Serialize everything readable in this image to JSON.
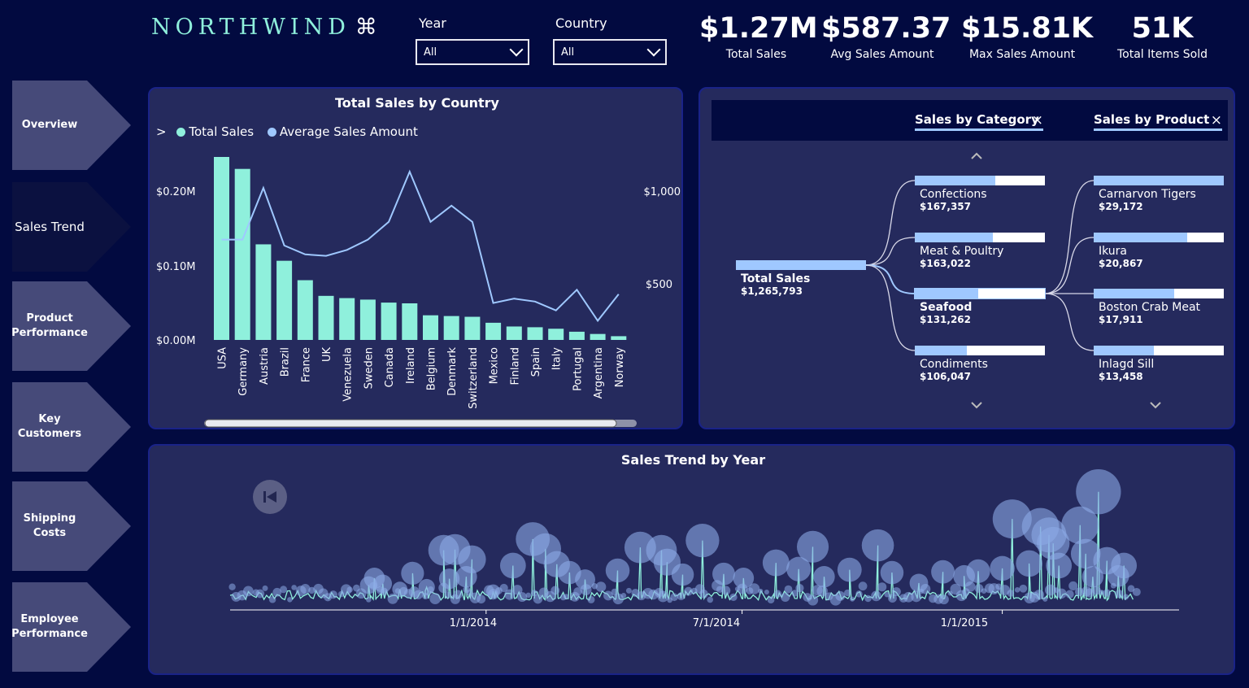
{
  "header": {
    "brand": "NORTHWIND",
    "brand_icon": "⌘",
    "filters": [
      {
        "label": "Year",
        "value": "All"
      },
      {
        "label": "Country",
        "value": "All"
      }
    ],
    "kpis": [
      {
        "value": "$1.27M",
        "label": "Total Sales"
      },
      {
        "value": "$587.37",
        "label": "Avg Sales Amount"
      },
      {
        "value": "$15.81K",
        "label": "Max Sales Amount"
      },
      {
        "value": "51K",
        "label": "Total Items Sold"
      }
    ]
  },
  "nav": [
    {
      "label": "Overview",
      "active": false
    },
    {
      "label": "Sales Trend",
      "active": true
    },
    {
      "label": "Product Performance",
      "active": false
    },
    {
      "label": "Key Customers",
      "active": false
    },
    {
      "label": "Shipping Costs",
      "active": false
    },
    {
      "label": "Employee Performance",
      "active": false
    }
  ],
  "country_chart": {
    "title": "Total Sales by Country",
    "legend_marker": ">",
    "legend": [
      {
        "name": "Total Sales",
        "color": "#8ff0dc"
      },
      {
        "name": "Average Sales Amount",
        "color": "#9fc8ff"
      }
    ],
    "y_left_ticks": [
      "$0.20M",
      "$0.10M",
      "$0.00M"
    ],
    "y_right_ticks": [
      "$1,000",
      "$500"
    ]
  },
  "decomp_tree": {
    "headers": [
      "Sales by Category",
      "Sales by Product"
    ],
    "root": {
      "name": "Total Sales",
      "value": "$1,265,793",
      "fraction": 1.0
    },
    "categories": [
      {
        "name": "Confections",
        "value": "$167,357",
        "fraction": 0.62
      },
      {
        "name": "Meat & Poultry",
        "value": "$163,022",
        "fraction": 0.6
      },
      {
        "name": "Seafood",
        "value": "$131,262",
        "fraction": 0.49,
        "selected": true
      },
      {
        "name": "Condiments",
        "value": "$106,047",
        "fraction": 0.4
      }
    ],
    "products": [
      {
        "name": "Carnarvon Tigers",
        "value": "$29,172",
        "fraction": 1.0
      },
      {
        "name": "Ikura",
        "value": "$20,867",
        "fraction": 0.72
      },
      {
        "name": "Boston Crab Meat",
        "value": "$17,911",
        "fraction": 0.62
      },
      {
        "name": "Inlagd Sill",
        "value": "$13,458",
        "fraction": 0.46
      }
    ]
  },
  "trend_chart": {
    "title": "Sales Trend by Year",
    "x_ticks": [
      "1/1/2014",
      "7/1/2014",
      "1/1/2015"
    ]
  },
  "chart_data": [
    {
      "type": "bar",
      "title": "Total Sales by Country",
      "categories": [
        "USA",
        "Germany",
        "Austria",
        "Brazil",
        "France",
        "UK",
        "Venezuela",
        "Sweden",
        "Canada",
        "Ireland",
        "Belgium",
        "Denmark",
        "Switzerland",
        "Mexico",
        "Finland",
        "Spain",
        "Italy",
        "Portugal",
        "Argentina",
        "Norway"
      ],
      "series": [
        {
          "name": "Total Sales",
          "axis": "left",
          "type": "bar",
          "values": [
            245000,
            229000,
            128000,
            106000,
            80000,
            59000,
            56000,
            54000,
            50000,
            49000,
            33000,
            32000,
            31000,
            23000,
            18000,
            17000,
            15000,
            11000,
            8000,
            5000
          ]
        },
        {
          "name": "Average Sales Amount",
          "axis": "right",
          "type": "line",
          "values": [
            680,
            680,
            1030,
            640,
            580,
            570,
            610,
            680,
            800,
            1140,
            800,
            910,
            800,
            250,
            280,
            260,
            200,
            340,
            130,
            310
          ]
        }
      ],
      "ylim_left": [
        0,
        245000
      ],
      "ylim_right": [
        0,
        1240
      ],
      "legend": "top-left"
    },
    {
      "type": "line",
      "title": "Sales Trend by Year",
      "x_ticks": [
        "1/1/2014",
        "7/1/2014",
        "1/1/2015"
      ],
      "x_range": [
        "2013-07-04",
        "2015-05-06"
      ],
      "note_markers": "bubble size proportional to order value",
      "points": [
        {
          "date": "2013-10-10",
          "value": 2400
        },
        {
          "date": "2013-10-14",
          "value": 3400
        },
        {
          "date": "2013-10-20",
          "value": 2600
        },
        {
          "date": "2013-11-01",
          "value": 1800
        },
        {
          "date": "2013-11-10",
          "value": 4100
        },
        {
          "date": "2013-11-20",
          "value": 2100
        },
        {
          "date": "2013-12-02",
          "value": 7400
        },
        {
          "date": "2013-12-06",
          "value": 3300
        },
        {
          "date": "2013-12-10",
          "value": 7500
        },
        {
          "date": "2013-12-18",
          "value": 3600
        },
        {
          "date": "2013-12-22",
          "value": 6100
        },
        {
          "date": "2014-01-06",
          "value": 1500
        },
        {
          "date": "2014-01-20",
          "value": 5200
        },
        {
          "date": "2014-02-03",
          "value": 9000
        },
        {
          "date": "2014-02-12",
          "value": 7600
        },
        {
          "date": "2014-02-20",
          "value": 5400
        },
        {
          "date": "2014-03-01",
          "value": 4200
        },
        {
          "date": "2014-03-12",
          "value": 3200
        },
        {
          "date": "2014-04-04",
          "value": 4500
        },
        {
          "date": "2014-04-20",
          "value": 7800
        },
        {
          "date": "2014-05-05",
          "value": 7400
        },
        {
          "date": "2014-05-09",
          "value": 5700
        },
        {
          "date": "2014-05-20",
          "value": 3900
        },
        {
          "date": "2014-06-03",
          "value": 8800
        },
        {
          "date": "2014-06-18",
          "value": 4000
        },
        {
          "date": "2014-07-02",
          "value": 3400
        },
        {
          "date": "2014-07-25",
          "value": 5600
        },
        {
          "date": "2014-08-10",
          "value": 4700
        },
        {
          "date": "2014-08-20",
          "value": 7900
        },
        {
          "date": "2014-08-28",
          "value": 3600
        },
        {
          "date": "2014-09-15",
          "value": 4600
        },
        {
          "date": "2014-10-05",
          "value": 8100
        },
        {
          "date": "2014-10-15",
          "value": 4200
        },
        {
          "date": "2014-11-03",
          "value": 2700
        },
        {
          "date": "2014-11-20",
          "value": 4300
        },
        {
          "date": "2014-12-05",
          "value": 3700
        },
        {
          "date": "2014-12-15",
          "value": 4400
        },
        {
          "date": "2015-01-01",
          "value": 4800
        },
        {
          "date": "2015-01-08",
          "value": 11900
        },
        {
          "date": "2015-01-20",
          "value": 5500
        },
        {
          "date": "2015-01-28",
          "value": 10800
        },
        {
          "date": "2015-02-03",
          "value": 9600
        },
        {
          "date": "2015-02-06",
          "value": 8400
        },
        {
          "date": "2015-02-10",
          "value": 5200
        },
        {
          "date": "2015-02-25",
          "value": 11000
        },
        {
          "date": "2015-03-01",
          "value": 6900
        },
        {
          "date": "2015-03-06",
          "value": 3600
        },
        {
          "date": "2015-03-10",
          "value": 15800
        },
        {
          "date": "2015-03-16",
          "value": 5900
        },
        {
          "date": "2015-03-24",
          "value": 3700
        },
        {
          "date": "2015-03-28",
          "value": 5200
        }
      ]
    }
  ]
}
